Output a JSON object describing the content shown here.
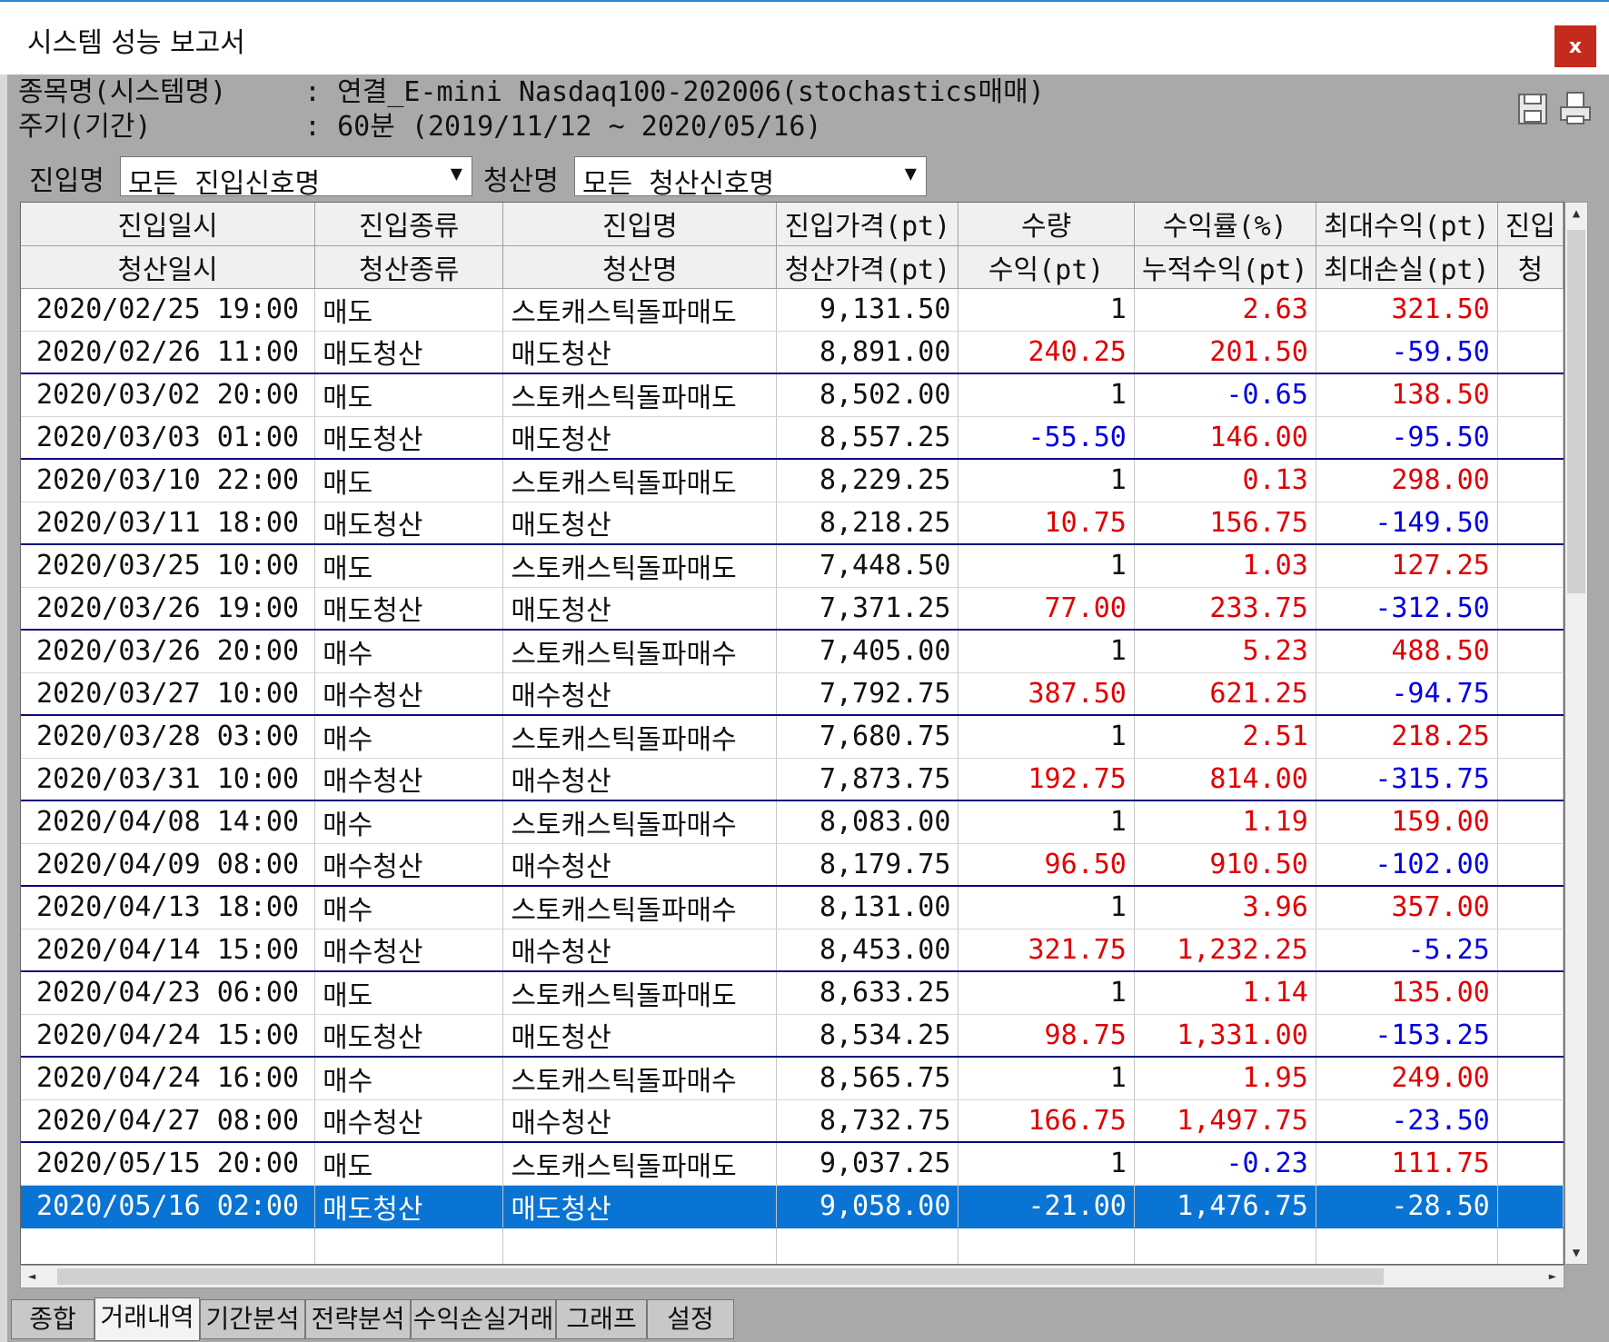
{
  "window": {
    "title": "시스템 성능 보고서",
    "close_label": "x"
  },
  "info": {
    "symbol_label": "종목명(시스템명)",
    "symbol_value": ": 연결_E-mini Nasdaq100-202006(stochastics매매)",
    "period_label": "주기(기간)",
    "period_value": ": 60분 (2019/11/12 ~ 2020/05/16)"
  },
  "toolbar": {
    "icons": [
      "save-icon",
      "print-icon"
    ]
  },
  "filters": {
    "entry_label": "진입명",
    "entry_value": "모든 진입신호명",
    "exit_label": "청산명",
    "exit_value": "모든 청산신호명"
  },
  "table": {
    "header_top": [
      "진입일시",
      "진입종류",
      "진입명",
      "진입가격(pt)",
      "수량",
      "수익률(%)",
      "최대수익(pt)",
      "진입"
    ],
    "header_bottom": [
      "청산일시",
      "청산종류",
      "청산명",
      "청산가격(pt)",
      "수익(pt)",
      "누적수익(pt)",
      "최대손실(pt)",
      "청"
    ],
    "rows": [
      [
        "2020/02/25 19:00",
        "매도",
        "스토캐스틱돌파매도",
        "9,131.50",
        "1",
        "2.63",
        "321.50"
      ],
      [
        "2020/02/26 11:00",
        "매도청산",
        "매도청산",
        "8,891.00",
        "240.25",
        "201.50",
        "-59.50"
      ],
      [
        "2020/03/02 20:00",
        "매도",
        "스토캐스틱돌파매도",
        "8,502.00",
        "1",
        "-0.65",
        "138.50"
      ],
      [
        "2020/03/03 01:00",
        "매도청산",
        "매도청산",
        "8,557.25",
        "-55.50",
        "146.00",
        "-95.50"
      ],
      [
        "2020/03/10 22:00",
        "매도",
        "스토캐스틱돌파매도",
        "8,229.25",
        "1",
        "0.13",
        "298.00"
      ],
      [
        "2020/03/11 18:00",
        "매도청산",
        "매도청산",
        "8,218.25",
        "10.75",
        "156.75",
        "-149.50"
      ],
      [
        "2020/03/25 10:00",
        "매도",
        "스토캐스틱돌파매도",
        "7,448.50",
        "1",
        "1.03",
        "127.25"
      ],
      [
        "2020/03/26 19:00",
        "매도청산",
        "매도청산",
        "7,371.25",
        "77.00",
        "233.75",
        "-312.50"
      ],
      [
        "2020/03/26 20:00",
        "매수",
        "스토캐스틱돌파매수",
        "7,405.00",
        "1",
        "5.23",
        "488.50"
      ],
      [
        "2020/03/27 10:00",
        "매수청산",
        "매수청산",
        "7,792.75",
        "387.50",
        "621.25",
        "-94.75"
      ],
      [
        "2020/03/28 03:00",
        "매수",
        "스토캐스틱돌파매수",
        "7,680.75",
        "1",
        "2.51",
        "218.25"
      ],
      [
        "2020/03/31 10:00",
        "매수청산",
        "매수청산",
        "7,873.75",
        "192.75",
        "814.00",
        "-315.75"
      ],
      [
        "2020/04/08 14:00",
        "매수",
        "스토캐스틱돌파매수",
        "8,083.00",
        "1",
        "1.19",
        "159.00"
      ],
      [
        "2020/04/09 08:00",
        "매수청산",
        "매수청산",
        "8,179.75",
        "96.50",
        "910.50",
        "-102.00"
      ],
      [
        "2020/04/13 18:00",
        "매수",
        "스토캐스틱돌파매수",
        "8,131.00",
        "1",
        "3.96",
        "357.00"
      ],
      [
        "2020/04/14 15:00",
        "매수청산",
        "매수청산",
        "8,453.00",
        "321.75",
        "1,232.25",
        "-5.25"
      ],
      [
        "2020/04/23 06:00",
        "매도",
        "스토캐스틱돌파매도",
        "8,633.25",
        "1",
        "1.14",
        "135.00"
      ],
      [
        "2020/04/24 15:00",
        "매도청산",
        "매도청산",
        "8,534.25",
        "98.75",
        "1,331.00",
        "-153.25"
      ],
      [
        "2020/04/24 16:00",
        "매수",
        "스토캐스틱돌파매수",
        "8,565.75",
        "1",
        "1.95",
        "249.00"
      ],
      [
        "2020/04/27 08:00",
        "매수청산",
        "매수청산",
        "8,732.75",
        "166.75",
        "1,497.75",
        "-23.50"
      ],
      [
        "2020/05/15 20:00",
        "매도",
        "스토캐스틱돌파매도",
        "9,037.25",
        "1",
        "-0.23",
        "111.75"
      ],
      [
        "2020/05/16 02:00",
        "매도청산",
        "매도청산",
        "9,058.00",
        "-21.00",
        "1,476.75",
        "-28.50"
      ]
    ],
    "selected_row": 21
  },
  "tabs": [
    "종합",
    "거래내역",
    "기간분석",
    "전략분석",
    "수익손실거래",
    "그래프",
    "설정"
  ],
  "active_tab": 1,
  "colors": {
    "positive": "#e00000",
    "negative": "#0000e0",
    "selection": "#0a74d4",
    "pair_divider": "#0a0a82"
  }
}
